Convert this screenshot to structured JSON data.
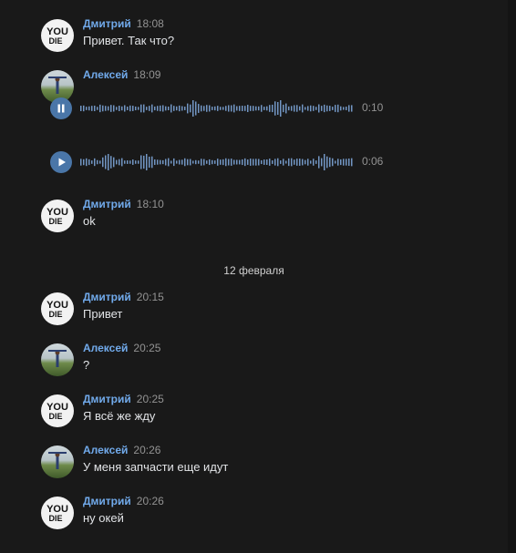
{
  "messages_top": [
    {
      "author": "Дмитрий",
      "time": "18:08",
      "text": "Привет. Так что?"
    },
    {
      "author": "Алексей",
      "time": "18:09"
    },
    {
      "author": "Дмитрий",
      "time": "18:10",
      "text": "ok"
    }
  ],
  "audio": [
    {
      "state": "pause-icon",
      "duration": "0:10"
    },
    {
      "state": "play-icon",
      "duration": "0:06"
    }
  ],
  "date_separator": "12 февраля",
  "messages_bottom": [
    {
      "author": "Дмитрий",
      "time": "20:15",
      "text": "Привет"
    },
    {
      "author": "Алексей",
      "time": "20:25",
      "text": "?"
    },
    {
      "author": "Дмитрий",
      "time": "20:25",
      "text": "Я всё же жду"
    },
    {
      "author": "Алексей",
      "time": "20:26",
      "text": "У меня запчасти еще идут"
    },
    {
      "author": "Дмитрий",
      "time": "20:26",
      "text": "ну окей"
    }
  ],
  "avatar_dm_text": [
    "YOU",
    "DIE"
  ],
  "colors": {
    "accent": "#71aaeb",
    "button": "#4a76a8",
    "bg": "#191919",
    "text": "#e1e3e6",
    "muted": "#939393"
  }
}
